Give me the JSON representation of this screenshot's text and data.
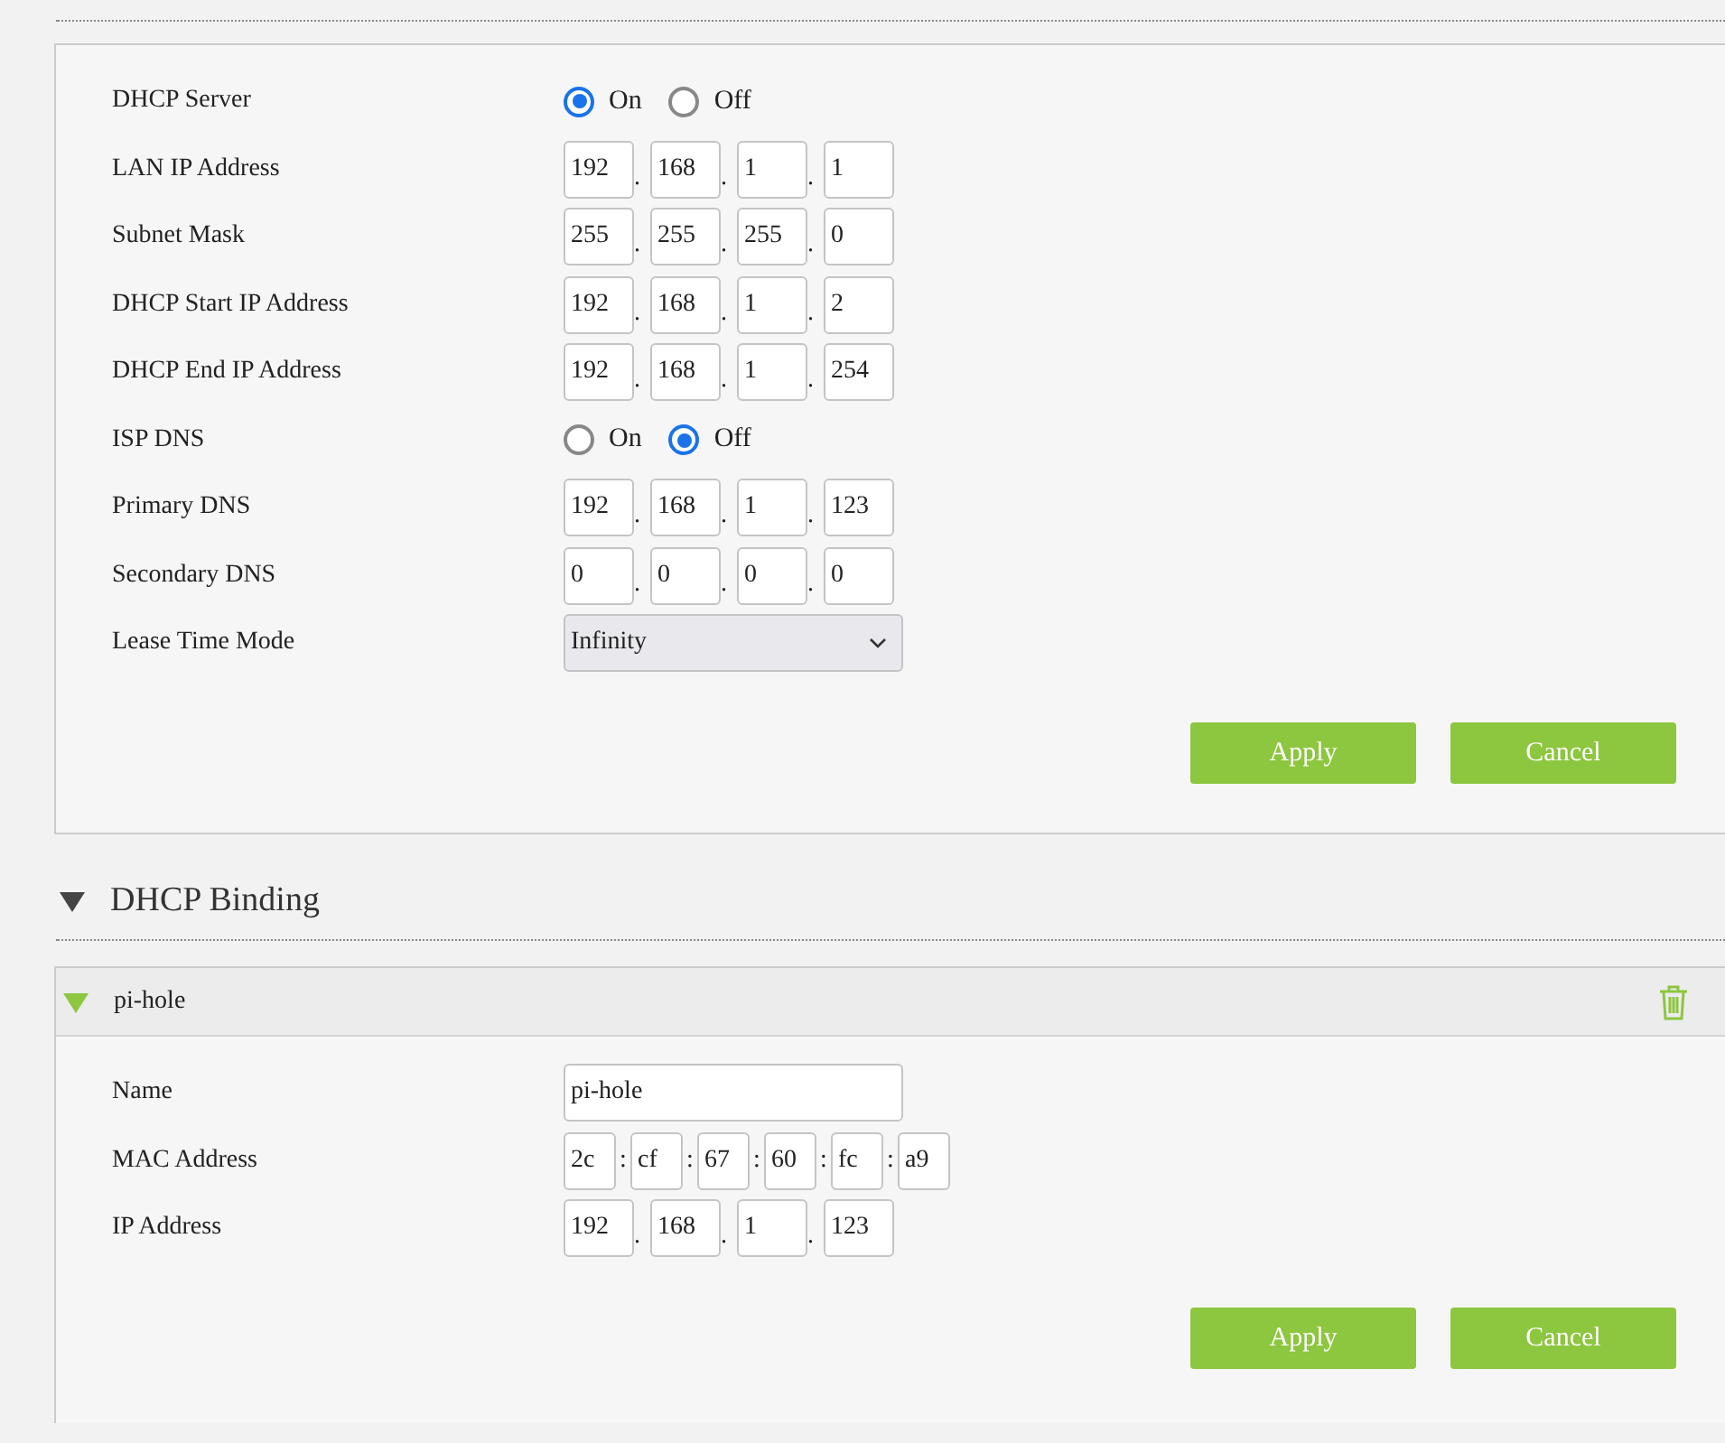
{
  "dhcp_settings": {
    "rows": [
      {
        "kind": "radio",
        "label": "DHCP Server",
        "options": [
          {
            "label": "On",
            "selected": true
          },
          {
            "label": "Off",
            "selected": false
          }
        ]
      },
      {
        "kind": "octets",
        "label": "LAN IP Address",
        "separator": ".",
        "values": [
          "192",
          "168",
          "1",
          "1"
        ]
      },
      {
        "kind": "octets",
        "label": "Subnet Mask",
        "separator": ".",
        "values": [
          "255",
          "255",
          "255",
          "0"
        ]
      },
      {
        "kind": "octets",
        "label": "DHCP Start IP Address",
        "separator": ".",
        "values": [
          "192",
          "168",
          "1",
          "2"
        ]
      },
      {
        "kind": "octets",
        "label": "DHCP End IP Address",
        "separator": ".",
        "values": [
          "192",
          "168",
          "1",
          "254"
        ]
      },
      {
        "kind": "radio",
        "label": "ISP DNS",
        "options": [
          {
            "label": "On",
            "selected": false
          },
          {
            "label": "Off",
            "selected": true
          }
        ]
      },
      {
        "kind": "octets",
        "label": "Primary DNS",
        "separator": ".",
        "values": [
          "192",
          "168",
          "1",
          "123"
        ]
      },
      {
        "kind": "octets",
        "label": "Secondary DNS",
        "separator": ".",
        "values": [
          "0",
          "0",
          "0",
          "0"
        ]
      },
      {
        "kind": "select",
        "label": "Lease Time Mode",
        "value": "Infinity"
      }
    ],
    "buttons": [
      "Apply",
      "Cancel"
    ]
  },
  "dhcp_binding": {
    "title": "DHCP Binding",
    "expanded": true,
    "entries": [
      {
        "title": "pi-hole",
        "expanded": true,
        "rows": [
          {
            "kind": "text",
            "label": "Name",
            "value": "pi-hole"
          },
          {
            "kind": "mac",
            "label": "MAC Address",
            "separator": ":",
            "values": [
              "2c",
              "cf",
              "67",
              "60",
              "fc",
              "a9"
            ]
          },
          {
            "kind": "octets",
            "label": "IP Address",
            "separator": ".",
            "values": [
              "192",
              "168",
              "1",
              "123"
            ]
          }
        ],
        "buttons": [
          "Apply",
          "Cancel"
        ]
      }
    ]
  }
}
